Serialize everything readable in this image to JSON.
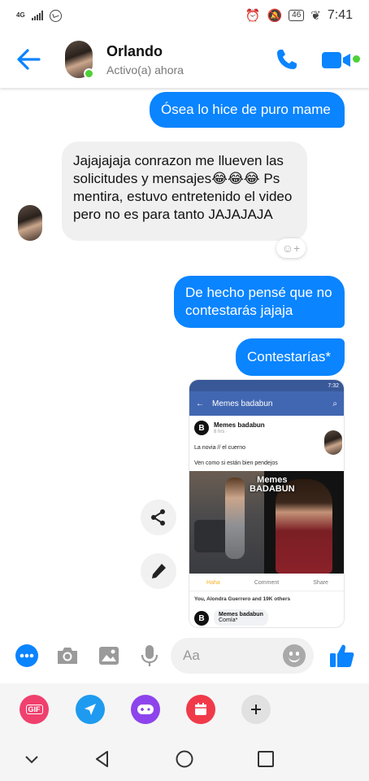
{
  "status_bar": {
    "network": "4G",
    "battery": "46",
    "time": "7:41"
  },
  "header": {
    "contact_name": "Orlando",
    "contact_status": "Activo(a) ahora"
  },
  "messages": [
    {
      "direction": "outgoing",
      "text": "Ósea lo hice de puro mame"
    },
    {
      "direction": "incoming",
      "text": "Jajajajaja conrazon me llueven las solicitudes y mensajes😂😂😂 Ps mentira, estuvo entretenido el video pero no es para tanto JAJAJAJA"
    },
    {
      "direction": "outgoing",
      "text": "De hecho pensé que no contestarás jajaja"
    },
    {
      "direction": "outgoing",
      "text": "Contestarías*"
    }
  ],
  "shared_image": {
    "status_time": "7:32",
    "app_bar_title": "Memes badabun",
    "post_page": "Memes badabun",
    "post_time": "8 hrs ·",
    "post_text_1": "La novia // el cuerno",
    "post_text_2": "Ven como si están bien pendejos",
    "watermark_line1": "Memes",
    "watermark_line2": "BADABUN",
    "action_like": "Haha",
    "action_comment": "Comment",
    "action_share": "Share",
    "reactions_text": "You, Alondra Guerrero and 19K others",
    "comment_author": "Memes badabun",
    "comment_text": "Comía*"
  },
  "composer": {
    "placeholder": "Aa"
  },
  "colors": {
    "accent": "#0a84ff",
    "online": "#4cd137",
    "gif": "#f0406e",
    "location": "#1e9bf0",
    "games": "#8e44ec",
    "calendar": "#f03a4a"
  },
  "tray": {
    "gif_label": "GIF"
  }
}
